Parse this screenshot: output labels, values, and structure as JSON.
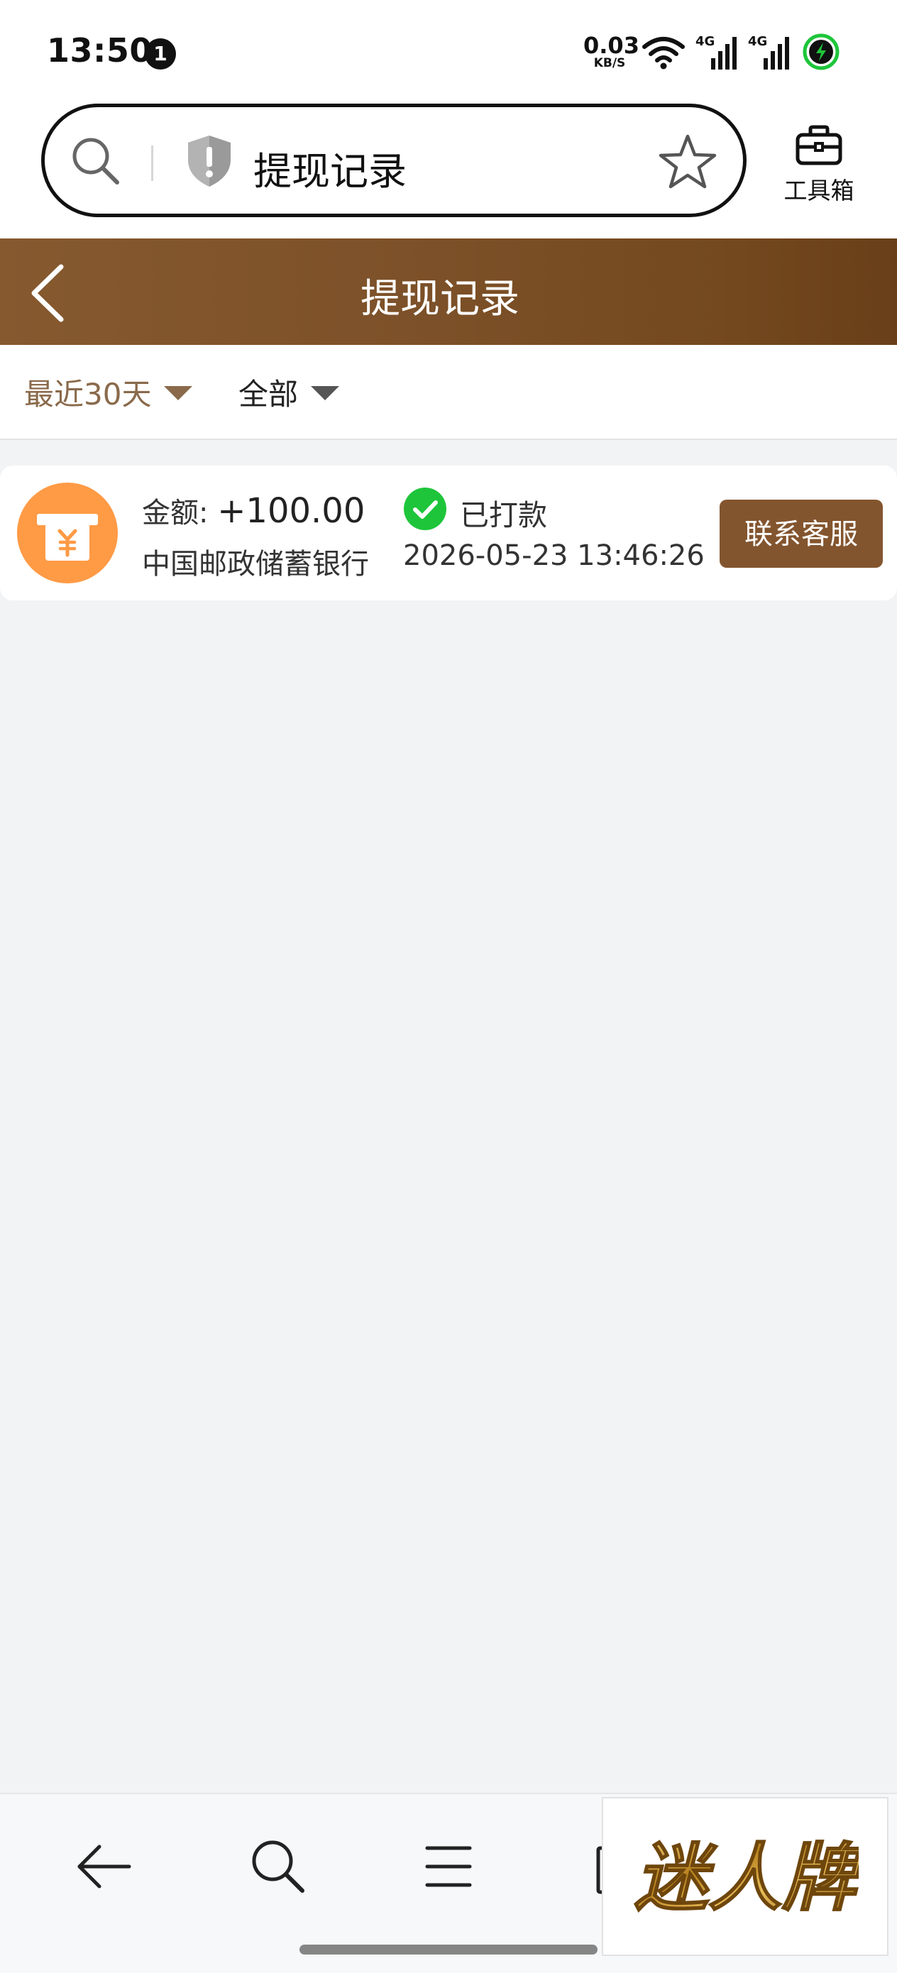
{
  "status_bar": {
    "time": "13:50",
    "notification_count": "1",
    "net_speed_value": "0.03",
    "net_speed_unit": "KB/S",
    "signal_1_label": "4G",
    "signal_2_label": "4G",
    "icons": [
      "wifi-icon",
      "signal-icon",
      "signal-icon",
      "battery-charging-icon"
    ]
  },
  "browser": {
    "url_title": "提现记录",
    "toolbox_label": "工具箱",
    "icons": [
      "search-icon",
      "security-shield-icon",
      "star-icon",
      "toolbox-icon"
    ]
  },
  "header": {
    "title": "提现记录",
    "back_icon": "chevron-left-icon"
  },
  "filters": {
    "range_label": "最近30天",
    "status_label": "全部"
  },
  "records": [
    {
      "amount_label": "金额: ",
      "amount_value": "+100.00",
      "bank": "中国邮政储蓄银行",
      "status": "已打款",
      "time": "2026-05-23 13:46:26",
      "action_label": "联系客服",
      "icon": "withdraw-yuan-icon"
    }
  ],
  "bottom_nav": {
    "icons": [
      "back-arrow-icon",
      "search-icon",
      "menu-icon",
      "tabs-icon"
    ],
    "brand_text": "迷人牌"
  },
  "colors": {
    "header_brown": "#7d5129",
    "button_brown": "#83552f",
    "filter_active": "#8a6a4b",
    "record_icon_orange": "#ff9a45",
    "success_green": "#1ec53a",
    "background": "#f2f3f5"
  }
}
